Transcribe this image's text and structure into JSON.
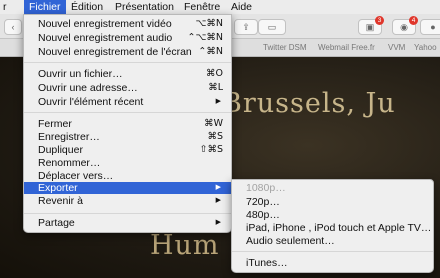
{
  "menubar": {
    "items": [
      "Fichier",
      "Édition",
      "Présentation",
      "Fenêtre",
      "Aide"
    ],
    "partial": "r"
  },
  "toolbar": {
    "badges": [
      "3",
      "4"
    ]
  },
  "favorites": [
    "Twitter DSM",
    "Webmail Free.fr",
    "VVM",
    "Yahoo"
  ],
  "page": {
    "hero_top": "Brussels, Ju",
    "hero_bottom": "Hum"
  },
  "fichier_menu": {
    "items": [
      {
        "label": "Nouvel enregistrement vidéo",
        "shortcut": "⌥⌘N"
      },
      {
        "label": "Nouvel enregistrement audio",
        "shortcut": "⌃⌥⌘N"
      },
      {
        "label": "Nouvel enregistrement de l'écran",
        "shortcut": "⌃⌘N"
      },
      {
        "label": "Ouvrir un fichier…",
        "shortcut": "⌘O"
      },
      {
        "label": "Ouvrir une adresse…",
        "shortcut": "⌘L"
      },
      {
        "label": "Ouvrir l'élément récent",
        "shortcut": "▶"
      },
      {
        "label": "Fermer",
        "shortcut": "⌘W"
      },
      {
        "label": "Enregistrer…",
        "shortcut": "⌘S"
      },
      {
        "label": "Dupliquer",
        "shortcut": "⇧⌘S"
      },
      {
        "label": "Renommer…",
        "shortcut": ""
      },
      {
        "label": "Déplacer vers…",
        "shortcut": ""
      },
      {
        "label": "Exporter",
        "shortcut": "▶"
      },
      {
        "label": "Revenir à",
        "shortcut": "▶"
      },
      {
        "label": "Partage",
        "shortcut": "▶"
      }
    ]
  },
  "export_menu": {
    "items": [
      {
        "label": "1080p…",
        "enabled": false
      },
      {
        "label": "720p…",
        "enabled": true
      },
      {
        "label": "480p…",
        "enabled": true
      },
      {
        "label": "iPad, iPhone , iPod touch et Apple TV…",
        "enabled": true
      },
      {
        "label": "Audio seulement…",
        "enabled": true
      },
      {
        "label": "iTunes…",
        "enabled": true
      }
    ]
  }
}
